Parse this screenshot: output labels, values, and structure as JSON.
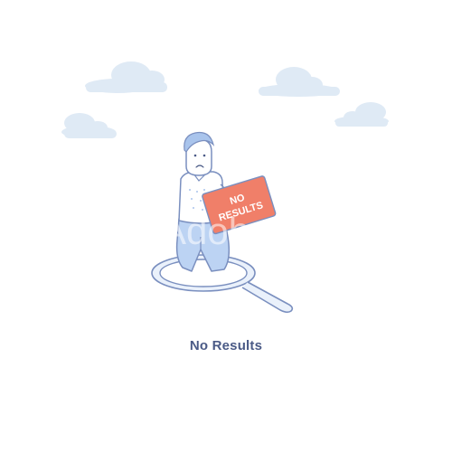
{
  "empty_state": {
    "title": "No Results",
    "sign_line1": "NO",
    "sign_line2": "RESULTS"
  },
  "watermark": {
    "text": "Adobe Stock"
  },
  "colors": {
    "cloud": "#dfeaf5",
    "outline": "#7a8fbf",
    "hair": "#a9c4ec",
    "body_fill": "#ffffff",
    "pants": "#bcd3f3",
    "sign": "#f07f69",
    "sign_text": "#ffffff",
    "title": "#4a5a86",
    "lens_fill": "#eaf1fb"
  },
  "icons": {
    "search": "magnifying-glass-icon",
    "sign": "no-results-sign"
  }
}
